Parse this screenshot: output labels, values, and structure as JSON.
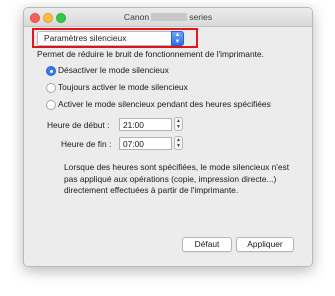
{
  "window": {
    "title_prefix": "Canon",
    "title_suffix": "series"
  },
  "dropdown": {
    "selected": "Paramètres silencieux"
  },
  "description": "Permet de réduire le bruit de fonctionnement de l'imprimante.",
  "radios": [
    {
      "label": "Désactiver le mode silencieux",
      "selected": true
    },
    {
      "label": "Toujours activer le mode silencieux",
      "selected": false
    },
    {
      "label": "Activer le mode silencieux pendant des heures spécifiées",
      "selected": false
    }
  ],
  "time_fields": {
    "start_label": "Heure de début :",
    "start_value": "21:00",
    "end_label": "Heure de fin :",
    "end_value": "07:00"
  },
  "note_lines": [
    "Lorsque des heures sont spécifiées, le mode silencieux n'est",
    "pas appliqué aux opérations (copie, impression directe...)",
    "directement effectuées à partir de l'imprimante."
  ],
  "buttons": {
    "default": "Défaut",
    "apply": "Appliquer"
  },
  "colors": {
    "highlight": "#e4161d",
    "accent": "#3478f6"
  }
}
